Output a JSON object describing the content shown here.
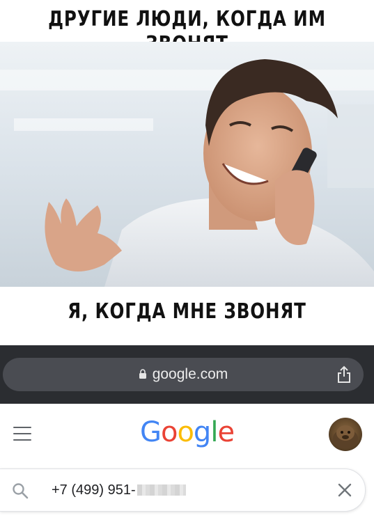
{
  "meme": {
    "top_caption": "ДРУГИЕ ЛЮДИ, КОГДА ИМ ЗВОНЯТ",
    "bottom_caption": "Я, КОГДА МНЕ ЗВОНЯТ"
  },
  "browser": {
    "url": "google.com"
  },
  "google": {
    "logo_letters": [
      {
        "char": "G",
        "color": "#4285F4"
      },
      {
        "char": "o",
        "color": "#EA4335"
      },
      {
        "char": "o",
        "color": "#FBBC05"
      },
      {
        "char": "g",
        "color": "#4285F4"
      },
      {
        "char": "l",
        "color": "#34A853"
      },
      {
        "char": "e",
        "color": "#EA4335"
      }
    ]
  },
  "search": {
    "query": "+7 (499) 951-"
  },
  "icons": {
    "lock": "lock-icon",
    "share": "share-icon",
    "menu": "hamburger-menu-icon",
    "search": "search-icon",
    "clear": "close-icon"
  }
}
